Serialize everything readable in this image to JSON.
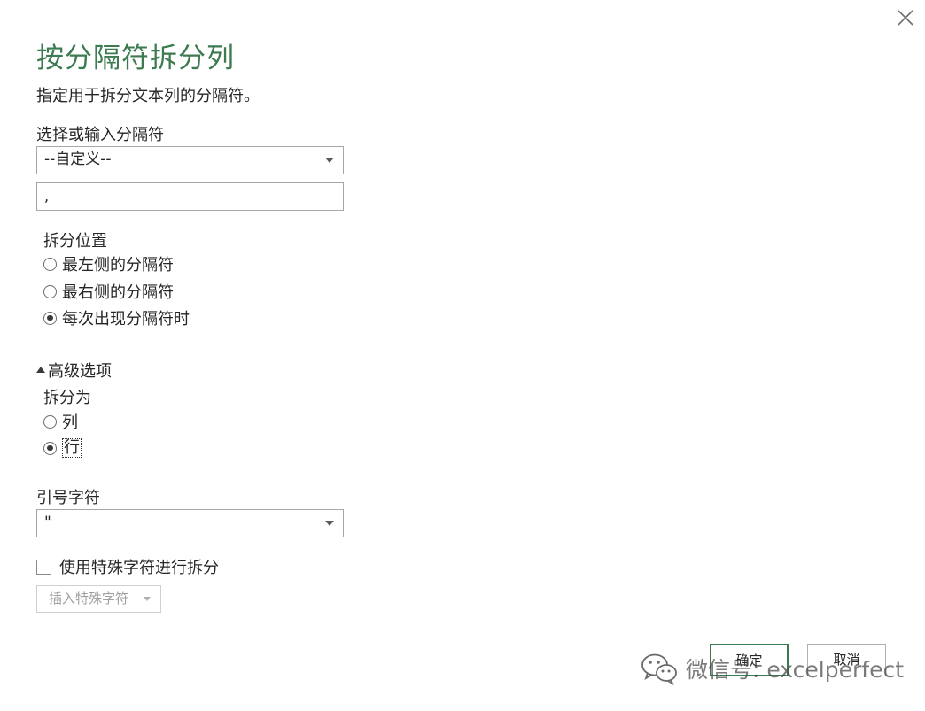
{
  "dialog": {
    "title": "按分隔符拆分列",
    "subtitle": "指定用于拆分文本列的分隔符。"
  },
  "delimiter": {
    "label": "选择或输入分隔符",
    "selected": "--自定义--",
    "custom_value": ","
  },
  "split_position": {
    "label": "拆分位置",
    "options": [
      {
        "label": "最左侧的分隔符",
        "checked": false
      },
      {
        "label": "最右侧的分隔符",
        "checked": false
      },
      {
        "label": "每次出现分隔符时",
        "checked": true
      }
    ]
  },
  "advanced": {
    "toggle_label": "高级选项",
    "split_into_label": "拆分为",
    "split_into": [
      {
        "label": "列",
        "checked": false
      },
      {
        "label": "行",
        "checked": true
      }
    ],
    "quote_label": "引号字符",
    "quote_selected": "\"",
    "special_chars_label": "使用特殊字符进行拆分",
    "special_chars_checked": false,
    "insert_special_label": "插入特殊字符"
  },
  "buttons": {
    "ok": "确定",
    "cancel": "取消"
  },
  "watermark": {
    "text": "微信号: excelperfect"
  },
  "colors": {
    "title": "#3c7a4f",
    "ok_border": "#3c7a4f"
  },
  "icons": {
    "close": "close-icon",
    "dropdown": "chevron-down-icon",
    "expand": "triangle-up-icon",
    "watermark": "wechat-logo"
  }
}
